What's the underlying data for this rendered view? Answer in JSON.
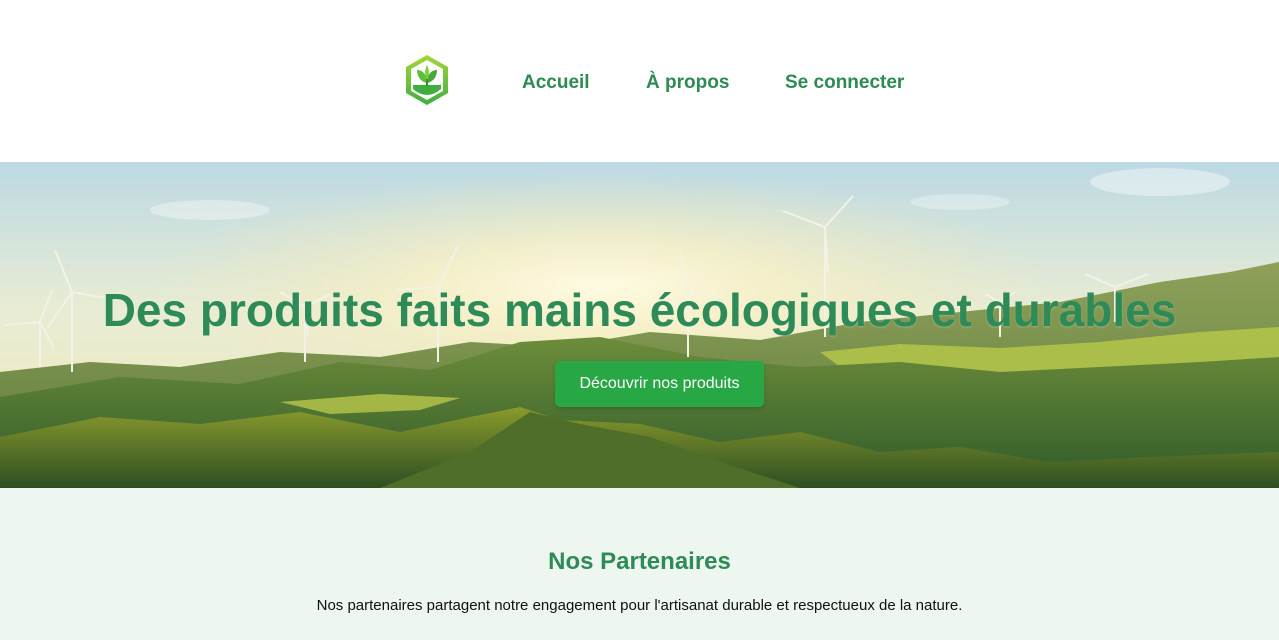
{
  "header": {
    "logo_icon": "leaf-hexagon-logo-icon",
    "nav": [
      {
        "label": "Accueil"
      },
      {
        "label": "À propos"
      },
      {
        "label": "Se connecter"
      }
    ]
  },
  "hero": {
    "background": "wind-turbines-landscape",
    "title": "Des produits faits mains écologiques et durables",
    "cta_label": "Découvrir nos produits"
  },
  "partners": {
    "title": "Nos Partenaires",
    "description": "Nos partenaires partagent notre engagement pour l'artisanat durable et respectueux de la nature."
  },
  "colors": {
    "brand_green": "#2e8b57",
    "button_green": "#28a745",
    "section_bg": "#edf6ef"
  }
}
